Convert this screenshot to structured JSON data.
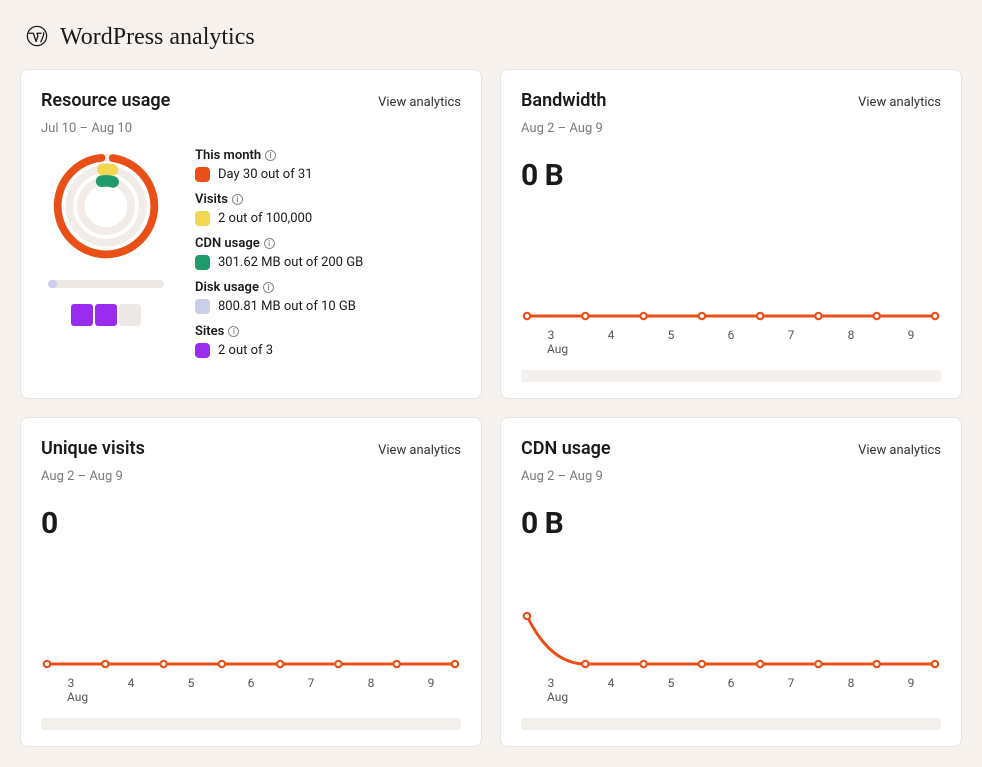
{
  "page_title": "WordPress analytics",
  "view_link_label": "View analytics",
  "colors": {
    "orange": "#ea4f17",
    "yellow": "#f2d750",
    "green": "#219a6c",
    "blue": "#c9cfe8",
    "purple": "#9a2cf0"
  },
  "resource_card": {
    "title": "Resource usage",
    "date_range": "Jul 10 – Aug 10",
    "metrics": {
      "this_month": {
        "title": "This month",
        "text": "Day 30 out of 31",
        "current": 30,
        "max": 31
      },
      "visits": {
        "title": "Visits",
        "text": "2 out of 100,000",
        "current": 2,
        "max": 100000
      },
      "cdn": {
        "title": "CDN usage",
        "text": "301.62 MB out of 200 GB",
        "current_mb": 301.62,
        "max_gb": 200
      },
      "disk": {
        "title": "Disk usage",
        "text": "800.81 MB out of 10 GB",
        "current_mb": 800.81,
        "max_gb": 10
      },
      "sites": {
        "title": "Sites",
        "text": "2 out of 3",
        "current": 2,
        "max": 3
      }
    }
  },
  "bandwidth_card": {
    "title": "Bandwidth",
    "date_range": "Aug 2 – Aug 9",
    "value_label": "0 B"
  },
  "visits_card": {
    "title": "Unique visits",
    "date_range": "Aug 2 – Aug 9",
    "value_label": "0"
  },
  "cdn_card": {
    "title": "CDN usage",
    "date_range": "Aug 2 – Aug 9",
    "value_label": "0 B"
  },
  "axis_month": "Aug",
  "chart_data": [
    {
      "id": "bandwidth",
      "type": "line",
      "title": "Bandwidth",
      "xlabel": "",
      "ylabel": "",
      "x": [
        2,
        3,
        4,
        5,
        6,
        7,
        8,
        9
      ],
      "series": [
        {
          "name": "Bandwidth",
          "values": [
            0,
            0,
            0,
            0,
            0,
            0,
            0,
            0
          ]
        }
      ],
      "ylim": [
        0,
        1
      ]
    },
    {
      "id": "unique_visits",
      "type": "line",
      "title": "Unique visits",
      "xlabel": "",
      "ylabel": "",
      "x": [
        2,
        3,
        4,
        5,
        6,
        7,
        8,
        9
      ],
      "series": [
        {
          "name": "Unique visits",
          "values": [
            0,
            0,
            0,
            0,
            0,
            0,
            0,
            0
          ]
        }
      ],
      "ylim": [
        0,
        1
      ]
    },
    {
      "id": "cdn_usage",
      "type": "line",
      "title": "CDN usage",
      "xlabel": "",
      "ylabel": "",
      "x": [
        2,
        3,
        4,
        5,
        6,
        7,
        8,
        9
      ],
      "series": [
        {
          "name": "CDN usage",
          "values": [
            1,
            0,
            0,
            0,
            0,
            0,
            0,
            0
          ]
        }
      ],
      "ylim": [
        0,
        1
      ]
    }
  ]
}
